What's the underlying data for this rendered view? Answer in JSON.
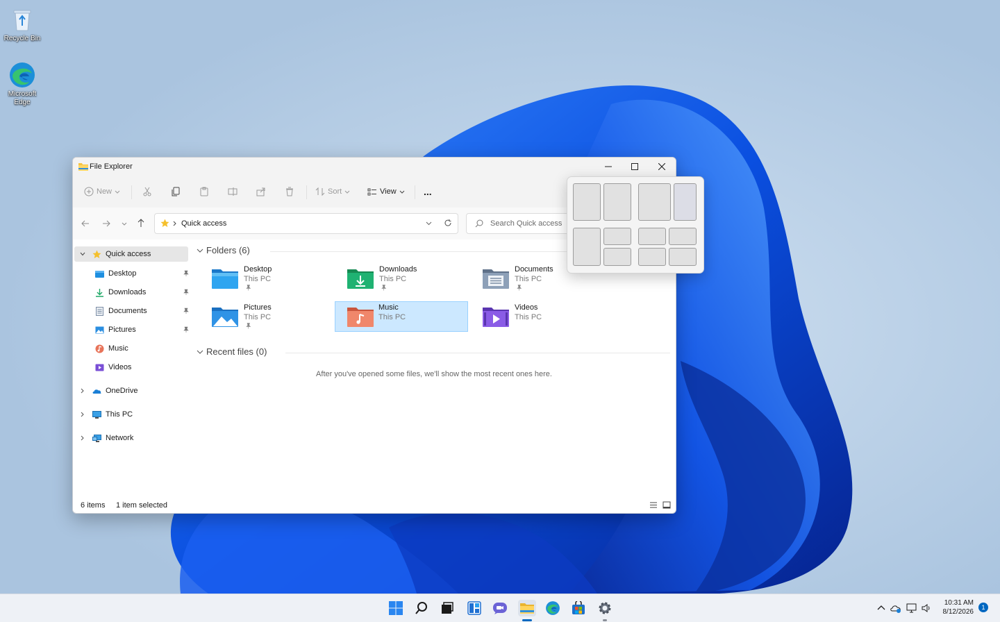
{
  "desktop": {
    "icons": [
      {
        "label": "Recycle Bin",
        "icon": "recycle-bin-icon"
      },
      {
        "label": "Microsoft Edge",
        "icon": "edge-icon"
      }
    ]
  },
  "window": {
    "title": "File Explorer",
    "toolbar": {
      "new_label": "New",
      "sort_label": "Sort",
      "view_label": "View",
      "more_label": "..."
    },
    "address": {
      "crumb": "Quick access"
    },
    "search": {
      "placeholder": "Search Quick access"
    },
    "sidebar": {
      "quick_access": "Quick access",
      "pinned": [
        {
          "label": "Desktop",
          "icon": "desktop-folder-icon"
        },
        {
          "label": "Downloads",
          "icon": "downloads-icon"
        },
        {
          "label": "Documents",
          "icon": "documents-icon"
        },
        {
          "label": "Pictures",
          "icon": "pictures-icon"
        },
        {
          "label": "Music",
          "icon": "music-icon"
        },
        {
          "label": "Videos",
          "icon": "videos-icon"
        }
      ],
      "roots": [
        {
          "label": "OneDrive",
          "icon": "onedrive-icon"
        },
        {
          "label": "This PC",
          "icon": "this-pc-icon"
        },
        {
          "label": "Network",
          "icon": "network-icon"
        }
      ]
    },
    "folders_header": "Folders (6)",
    "folders": [
      {
        "name": "Desktop",
        "location": "This PC",
        "pinned": true,
        "color": "#1e8fe0"
      },
      {
        "name": "Downloads",
        "location": "This PC",
        "pinned": true,
        "color": "#1ea866"
      },
      {
        "name": "Documents",
        "location": "This PC",
        "pinned": true,
        "color": "#7c8ea6"
      },
      {
        "name": "Pictures",
        "location": "This PC",
        "pinned": true,
        "color": "#2a8ee0"
      },
      {
        "name": "Music",
        "location": "This PC",
        "pinned": false,
        "color": "#e8745a",
        "selected": true
      },
      {
        "name": "Videos",
        "location": "This PC",
        "pinned": false,
        "color": "#7a4fd6"
      }
    ],
    "recent_header": "Recent files (0)",
    "recent_empty": "After you've opened some files, we'll show the most recent ones here.",
    "status": {
      "items": "6 items",
      "selected": "1 item selected"
    }
  },
  "snap_layouts": {
    "layouts": [
      "two-equal",
      "two-wide-narrow",
      "three-left-big",
      "four-grid"
    ]
  },
  "taskbar": {
    "apps": [
      "start-icon",
      "search-icon",
      "task-view-icon",
      "widgets-icon",
      "chat-icon",
      "file-explorer-icon",
      "edge-icon",
      "store-icon",
      "settings-icon"
    ],
    "clock_time": "10:31 AM",
    "clock_date": "8/12/2026",
    "notification_count": "1"
  },
  "colors": {
    "accent": "#0067c0",
    "selection": "#cce8ff",
    "selection_border": "#99d1ff"
  }
}
